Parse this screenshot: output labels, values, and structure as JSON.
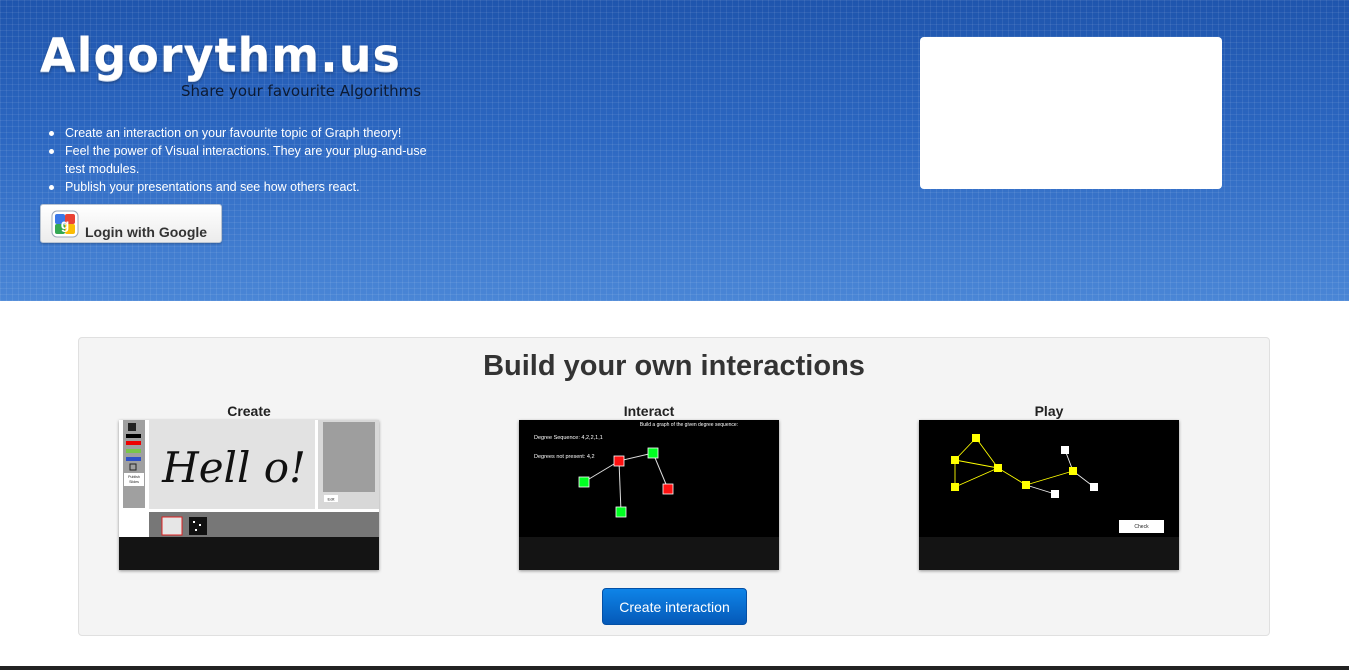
{
  "header": {
    "logo": "Algorythm.us",
    "tagline": "Share your favourite Algorithms",
    "features": [
      "Create an interaction on your favourite topic of Graph theory!",
      "Feel the power of Visual interactions. They are your plug-and-use test modules.",
      "Publish your presentations and see how others react."
    ],
    "login_label": "Login with Google"
  },
  "main": {
    "title": "Build your own interactions",
    "columns": [
      {
        "label": "Create"
      },
      {
        "label": "Interact"
      },
      {
        "label": "Play"
      }
    ],
    "create_shot": {
      "handwriting": "Hell o!",
      "publish_label": "Publish Slides",
      "edit_label": "Edit"
    },
    "interact_shot": {
      "prompt": "Build a graph of the given degree sequence:",
      "degree_sequence": "Degree Sequence: 4,2,2,1,1",
      "degrees_missing": "Degrees not present: 4,2"
    },
    "play_shot": {
      "check_label": "Check"
    },
    "cta_label": "Create interaction"
  },
  "colors": {
    "hero_blue": "#2f6cc4",
    "cta_blue": "#0a6fd6",
    "node_green": "#00ff22",
    "node_red": "#ff1111",
    "node_yellow": "#ffff00"
  }
}
